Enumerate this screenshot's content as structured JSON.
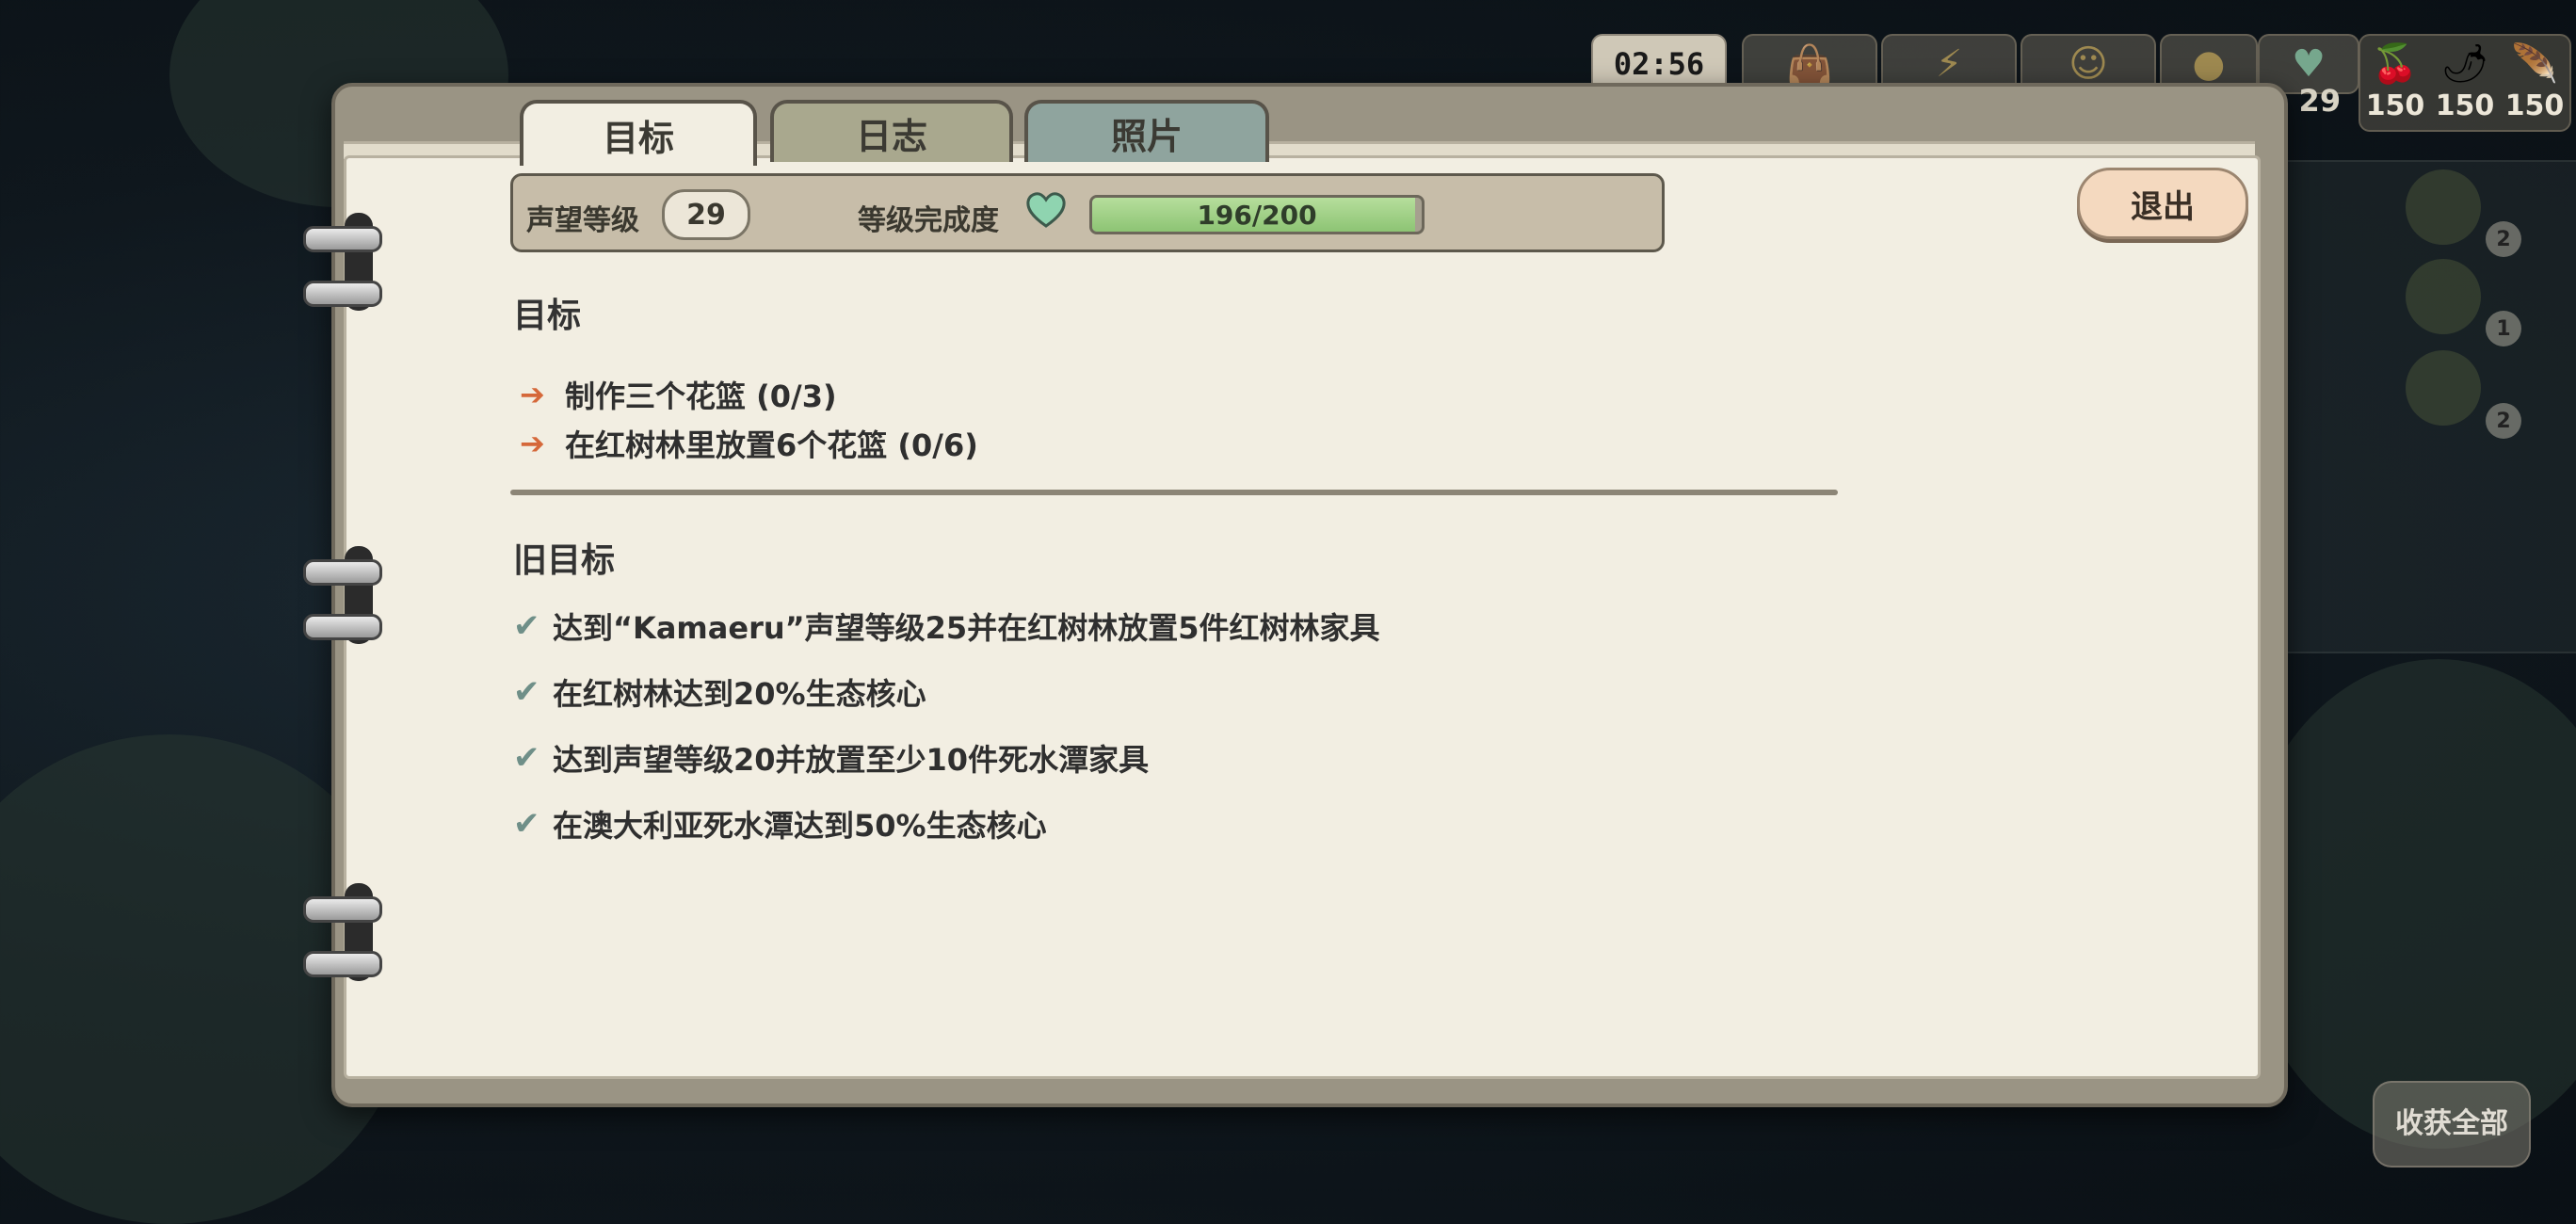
{
  "hud": {
    "time": "02:56",
    "level_text": "v. 29",
    "resources": [
      {
        "icon": "berries-icon",
        "glyph": "🍒",
        "value": "150"
      },
      {
        "icon": "pepper-icon",
        "glyph": "🌶",
        "value": "150"
      },
      {
        "icon": "feather-icon",
        "glyph": "🪶",
        "value": "150"
      }
    ],
    "side_counts": [
      "2",
      "1",
      "2"
    ],
    "harvest_all_label": "收获全部"
  },
  "tabs": {
    "goals": "目标",
    "log": "日志",
    "photos": "照片"
  },
  "rank": {
    "label": "声望等级",
    "level": "29",
    "completion_label": "等级完成度",
    "progress_text": "196/200",
    "progress_fraction": 0.98,
    "heart_color": "#8fd4b0"
  },
  "exit_label": "退出",
  "goals": {
    "title": "目标",
    "items": [
      "制作三个花篮 (0/3)",
      "在红树林里放置6个花篮 (0/6)"
    ]
  },
  "old_goals": {
    "title": "旧目标",
    "items": [
      "达到“Kamaeru”声望等级25并在红树林放置5件红树林家具",
      "在红树林达到20%生态核心",
      "达到声望等级20并放置至少10件死水潭家具",
      "在澳大利亚死水潭达到50%生态核心"
    ]
  },
  "colors": {
    "arrow": "#d5683a",
    "check": "#6f8f88",
    "progress_fill": "#9ccf82",
    "exit_button": "#f4d9bf"
  }
}
